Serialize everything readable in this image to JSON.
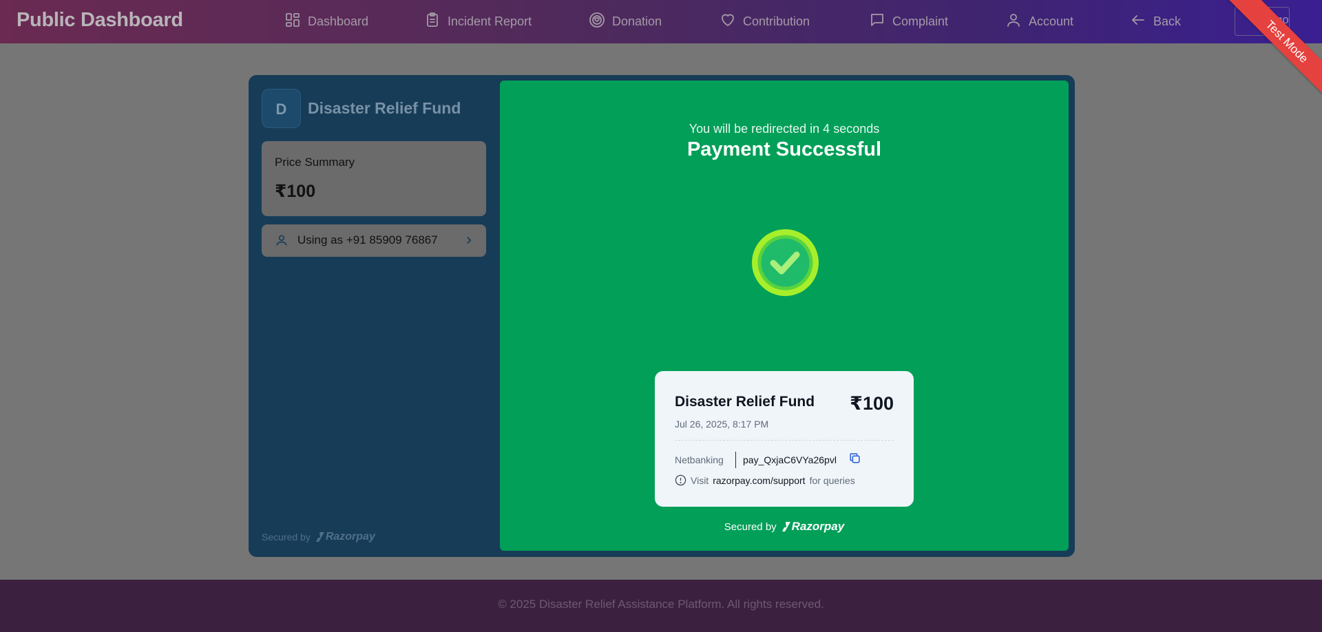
{
  "navbar": {
    "brand": "Public Dashboard",
    "items": [
      {
        "label": "Dashboard",
        "icon": "grid-icon"
      },
      {
        "label": "Incident Report",
        "icon": "clipboard-icon"
      },
      {
        "label": "Donation",
        "icon": "donation-icon"
      },
      {
        "label": "Contribution",
        "icon": "heart-icon"
      },
      {
        "label": "Complaint",
        "icon": "message-icon"
      },
      {
        "label": "Account",
        "icon": "user-icon"
      },
      {
        "label": "Back",
        "icon": "arrow-left-icon"
      }
    ],
    "logout_label": "Logout"
  },
  "checkout": {
    "merchant_initial": "D",
    "merchant_name": "Disaster Relief Fund",
    "price_summary_label": "Price Summary",
    "price_value": "₹100",
    "contact_label": "Using as +91 85909 76867",
    "secured_by_label": "Secured by",
    "secured_brand": "Razorpay",
    "success": {
      "redirect_text": "You will be redirected in 4 seconds",
      "title": "Payment Successful",
      "receipt": {
        "merchant": "Disaster Relief Fund",
        "amount": "₹100",
        "date": "Jul 26, 2025, 8:17 PM",
        "method": "Netbanking",
        "payment_id": "pay_QxjaC6VYa26pvl",
        "info_prefix": "Visit",
        "info_link": "razorpay.com/support",
        "info_suffix": "for queries"
      }
    },
    "test_mode_label": "Test Mode"
  },
  "footer": {
    "text": "© 2025 Disaster Relief Assistance Platform. All rights reserved."
  },
  "colors": {
    "modal_bg": "#173c57",
    "success_green": "#019f58",
    "ribbon_red": "#e5413e",
    "copy_blue": "#2f64d6"
  }
}
